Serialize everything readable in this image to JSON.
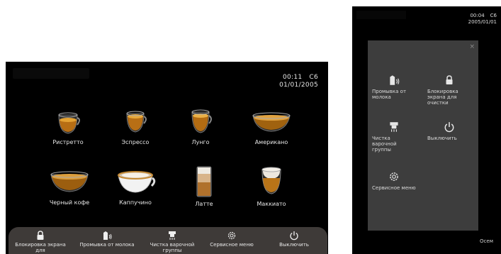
{
  "main_screen": {
    "time": "00:11",
    "code": "C6",
    "date": "01/01/2005",
    "drinks": [
      {
        "label": "Ристретто",
        "icon": "ristretto-cup-icon"
      },
      {
        "label": "Эспрессо",
        "icon": "espresso-cup-icon"
      },
      {
        "label": "Лунго",
        "icon": "lungo-cup-icon"
      },
      {
        "label": "Американо",
        "icon": "americano-cup-icon"
      },
      {
        "label": "Черный кофе",
        "icon": "black-coffee-cup-icon"
      },
      {
        "label": "Каппучино",
        "icon": "cappuccino-cup-icon"
      },
      {
        "label": "Латте",
        "icon": "latte-glass-icon"
      },
      {
        "label": "Маккиато",
        "icon": "macchiato-glass-icon"
      }
    ],
    "toolbar": [
      {
        "label": "Блокировка экрана для",
        "icon": "lock-icon"
      },
      {
        "label": "Промывка от молока",
        "icon": "milk-rinse-icon"
      },
      {
        "label": "Чистка варочной группы",
        "icon": "brew-group-clean-icon"
      },
      {
        "label": "Сервисное меню",
        "icon": "gear-icon"
      },
      {
        "label": "Выключить",
        "icon": "power-icon"
      }
    ]
  },
  "side_screen": {
    "time": "00:04",
    "code": "C6",
    "date": "2005/01/01",
    "menu": [
      {
        "label": "Промывка от молока",
        "icon": "milk-rinse-icon"
      },
      {
        "label": "Блокировка экрана для очистки",
        "icon": "lock-icon"
      },
      {
        "label": "Чистка варочной группы",
        "icon": "brew-group-clean-icon"
      },
      {
        "label": "Выключить",
        "icon": "power-icon"
      },
      {
        "label": "Сервисное меню",
        "icon": "gear-icon"
      }
    ],
    "footer": "Осем"
  },
  "colors": {
    "screen_bg": "#000000",
    "toolbar_bg": "#3e3a38",
    "overlay_bg": "#3d3d3d",
    "coffee": "#c98a1e",
    "text": "#e6e6e6"
  }
}
